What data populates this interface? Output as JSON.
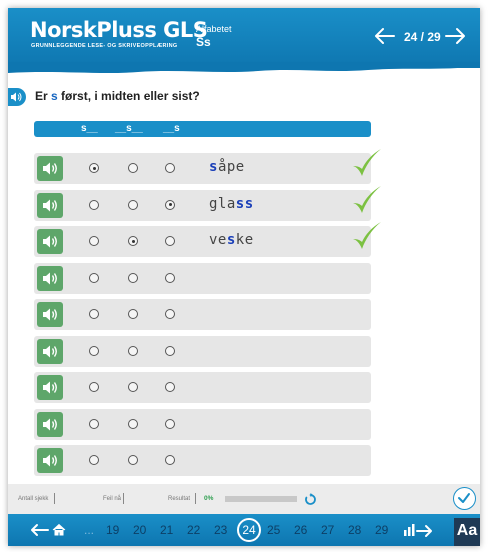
{
  "header": {
    "brand": "NorskPluss GLS",
    "brand_sub": "GRUNNLEGGENDE LESE- OG SKRIVEOPPLÆRING",
    "section_label": "Alfabetet",
    "section_value": "Ss",
    "page_count": "24 / 29"
  },
  "question": {
    "prefix": "Er ",
    "letter": "s",
    "suffix": " først, i midten eller sist?"
  },
  "columns": [
    "s__",
    "__s__",
    "__s"
  ],
  "rows": [
    {
      "selected": 0,
      "word_parts": [
        {
          "t": "s",
          "hl": true
        },
        {
          "t": "åpe",
          "hl": false
        }
      ],
      "correct": true
    },
    {
      "selected": 2,
      "word_parts": [
        {
          "t": "gla",
          "hl": false
        },
        {
          "t": "ss",
          "hl": true
        }
      ],
      "correct": true
    },
    {
      "selected": 1,
      "word_parts": [
        {
          "t": "ve",
          "hl": false
        },
        {
          "t": "s",
          "hl": true
        },
        {
          "t": "ke",
          "hl": false
        }
      ],
      "correct": true
    },
    {
      "selected": -1,
      "word_parts": [],
      "correct": false
    },
    {
      "selected": -1,
      "word_parts": [],
      "correct": false
    },
    {
      "selected": -1,
      "word_parts": [],
      "correct": false
    },
    {
      "selected": -1,
      "word_parts": [],
      "correct": false
    },
    {
      "selected": -1,
      "word_parts": [],
      "correct": false
    },
    {
      "selected": -1,
      "word_parts": [],
      "correct": false
    }
  ],
  "status": {
    "attempts_label": "Antall sjekk",
    "errors_label": "Feil nå",
    "result_label": "Resultat",
    "result_pct": "0%",
    "progress": 0
  },
  "bottom_nav": {
    "ellipsis": "...",
    "pages": [
      "19",
      "20",
      "21",
      "22",
      "23",
      "24",
      "25",
      "26",
      "27",
      "28",
      "29"
    ],
    "current": "24",
    "font_button": "Aa"
  },
  "colors": {
    "brand_blue": "#1a8fc8",
    "speaker_green": "#5ea66a",
    "check_green": "#7cc142",
    "highlight_blue": "#1a3fb8"
  },
  "icons": {
    "prev": "arrow-left-icon",
    "next": "arrow-right-icon",
    "speaker": "speaker-icon",
    "check": "checkmark-icon",
    "home": "home-icon",
    "reset": "reset-icon"
  }
}
